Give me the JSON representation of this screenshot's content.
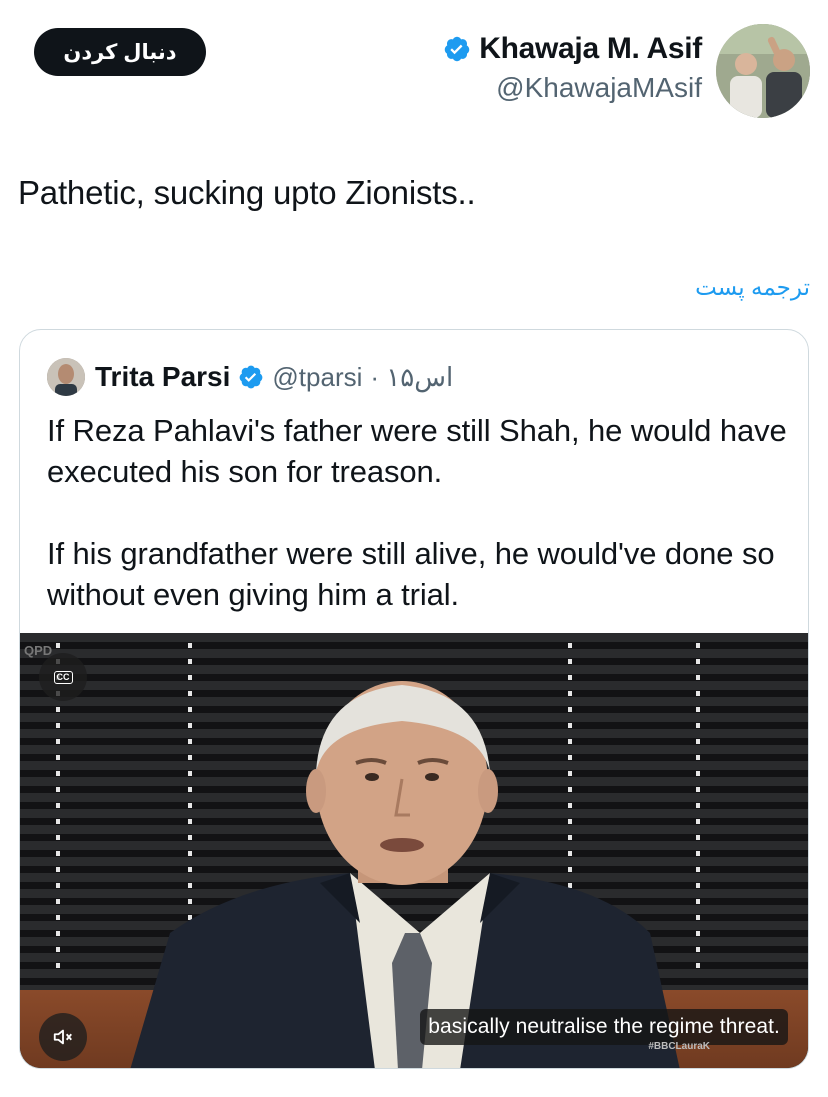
{
  "header": {
    "follow_label": "دنبال کردن",
    "display_name": "Khawaja M. Asif",
    "handle": "@KhawajaMAsif",
    "verified_icon": "verified-badge-icon"
  },
  "tweet": {
    "text": "Pathetic, sucking upto  Zionists..",
    "translate_label": "ترجمه پست"
  },
  "quote": {
    "display_name": "Trita Parsi",
    "handle": "@tparsi",
    "time": "· ۱۵اس",
    "paragraph_1": "If Reza Pahlavi's father were still Shah, he would have executed his son for treason.",
    "paragraph_2": "If his grandfather were still alive, he would've done so without even giving him a trial.",
    "video": {
      "caption": "basically neutralise the regime threat.",
      "cc_label": "CC",
      "cc_icon": "closed-captions-icon",
      "mute_icon": "speaker-muted-icon",
      "watermark": "QPD",
      "tag": "#BBCLauraK"
    }
  },
  "colors": {
    "accent": "#1d9bf0",
    "text": "#0f1419",
    "secondary": "#536471",
    "border": "#cfd9de"
  }
}
